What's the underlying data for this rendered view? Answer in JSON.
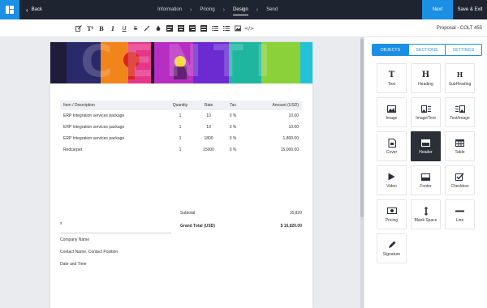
{
  "topbar": {
    "back_label": "Back",
    "steps": [
      "Information",
      "Pricing",
      "Design",
      "Send"
    ],
    "active_step": "Design",
    "next_label": "Next",
    "save_exit_label": "Save & Exit"
  },
  "toolbar": {
    "proposal_title": "Proposal - COLT 455"
  },
  "document": {
    "banner_text": "CENTI",
    "table": {
      "headers": [
        "Item / Description",
        "Quantity",
        "Rate",
        "Tax",
        "Amount (USD)"
      ],
      "rows": [
        [
          "ERP Integration services package",
          "1",
          "10",
          "0 %",
          "10.00"
        ],
        [
          "ERP Integration services package",
          "1",
          "10",
          "0 %",
          "10.00"
        ],
        [
          "ERP Integration services package",
          "1",
          "1800",
          "0 %",
          "1,800.00"
        ],
        [
          "Redcarpet",
          "1",
          "15000",
          "0 %",
          "15,000.00"
        ]
      ]
    },
    "subtotal_label": "Subtotal",
    "subtotal_value": "16,820",
    "grand_total_label": "Grand Total (USD)",
    "grand_total_value": "$ 16,820.00",
    "signature": {
      "x_mark": "x",
      "company_name": "Company Name",
      "contact": "Contact Name, Contact Position",
      "date_time": "Date and Time"
    }
  },
  "panel": {
    "tabs": [
      "OBJECTS",
      "SECTIONS",
      "SETTINGS"
    ],
    "active_tab": "OBJECTS",
    "objects": [
      {
        "label": "Text",
        "icon": "text-icon"
      },
      {
        "label": "Heading",
        "icon": "heading-icon"
      },
      {
        "label": "SubHeading",
        "icon": "subheading-icon"
      },
      {
        "label": "Image",
        "icon": "image-icon"
      },
      {
        "label": "Image/Text",
        "icon": "image-text-icon"
      },
      {
        "label": "Text/Image",
        "icon": "text-image-icon"
      },
      {
        "label": "Cover",
        "icon": "cover-icon"
      },
      {
        "label": "Header",
        "icon": "header-icon"
      },
      {
        "label": "Table",
        "icon": "table-icon"
      },
      {
        "label": "Video",
        "icon": "video-icon"
      },
      {
        "label": "Footer",
        "icon": "footer-icon"
      },
      {
        "label": "Checkbox",
        "icon": "checkbox-icon"
      },
      {
        "label": "Pricing",
        "icon": "pricing-icon"
      },
      {
        "label": "Blank Space",
        "icon": "blank-space-icon"
      },
      {
        "label": "Line",
        "icon": "line-icon"
      },
      {
        "label": "Signature",
        "icon": "signature-icon"
      }
    ],
    "selected_object": "Header"
  },
  "colors": {
    "topbar_bg": "#1e2430",
    "accent": "#1a8fe3",
    "selected_tile": "#2a2f38"
  }
}
